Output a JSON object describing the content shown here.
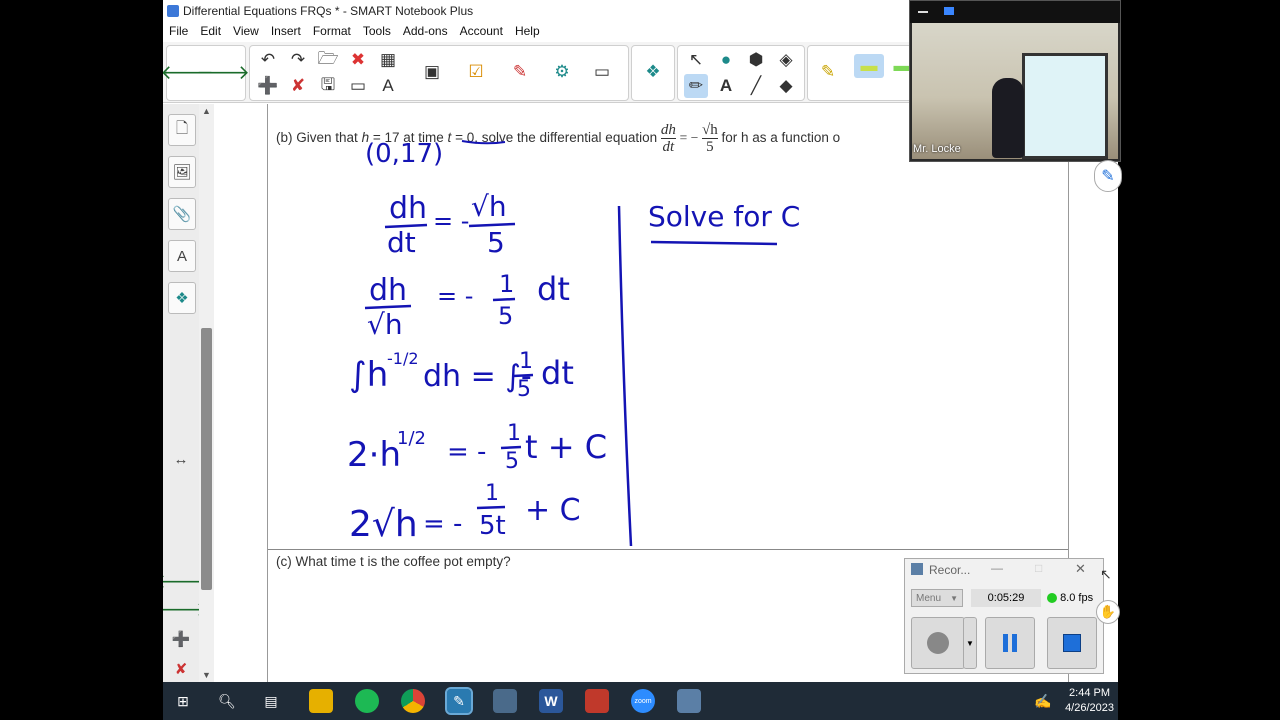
{
  "window": {
    "title": "Differential Equations FRQs * - SMART Notebook Plus"
  },
  "menu": [
    "File",
    "Edit",
    "View",
    "Insert",
    "Format",
    "Tools",
    "Add-ons",
    "Account",
    "Help"
  ],
  "page": {
    "question_b": {
      "prefix": "(b) Given that",
      "h_var": "h",
      "eq17": "= 17 at time",
      "t_var": "t",
      "eq0": "= 0,",
      "solve": "solve the differential equation",
      "frac_num": "dh",
      "frac_den": "dt",
      "equals_minus": "= −",
      "rhs_num": "√h",
      "rhs_den": "5",
      "suffix": "for h as a function o"
    },
    "question_c": "(c) What time t is the coffee pot empty?",
    "handwriting": {
      "point": "(0,17)",
      "line1_lhs_num": "dh",
      "line1_lhs_den": "dt",
      "line1_eq": "= -",
      "line1_rhs_num": "√h",
      "line1_rhs_den": "5",
      "line2_lhs_num": "dh",
      "line2_lhs_den": "√h",
      "line2_eq": "= -",
      "line2_rhs_num": "1",
      "line2_rhs_den": "5",
      "line2_dt": "dt",
      "line3_left": "∫h",
      "line3_exp": "-1/2",
      "line3_mid": "dh = ∫-",
      "line3_frac_num": "1",
      "line3_frac_den": "5",
      "line3_right": "dt",
      "line4_left": "2·h",
      "line4_exp": "1/2",
      "line4_eq": "= -",
      "line4_frac_num": "1",
      "line4_frac_den": "5",
      "line4_right": "t + C",
      "line5_left": "2√h",
      "line5_eq": "= -",
      "line5_frac_num": "1",
      "line5_frac_den": "5t",
      "line5_right": "+ C",
      "side_note": "Solve for C"
    }
  },
  "video": {
    "name": "Mr. Locke"
  },
  "recorder": {
    "title": "Recor...",
    "menu_label": "Menu",
    "elapsed": "0:05:29",
    "fps": "8.0 fps",
    "status_color": "#22cc22"
  },
  "taskbar": {
    "time": "2:44 PM",
    "date": "4/26/2023",
    "apps": [
      "start-icon",
      "search-icon",
      "task-view-icon",
      "file-explorer-icon",
      "spotify-icon",
      "chrome-icon",
      "smart-notebook-icon",
      "camera-app-icon",
      "word-icon",
      "smart-ink-icon",
      "zoom-icon",
      "recorder-icon"
    ]
  },
  "ink_color": "#1414b4"
}
